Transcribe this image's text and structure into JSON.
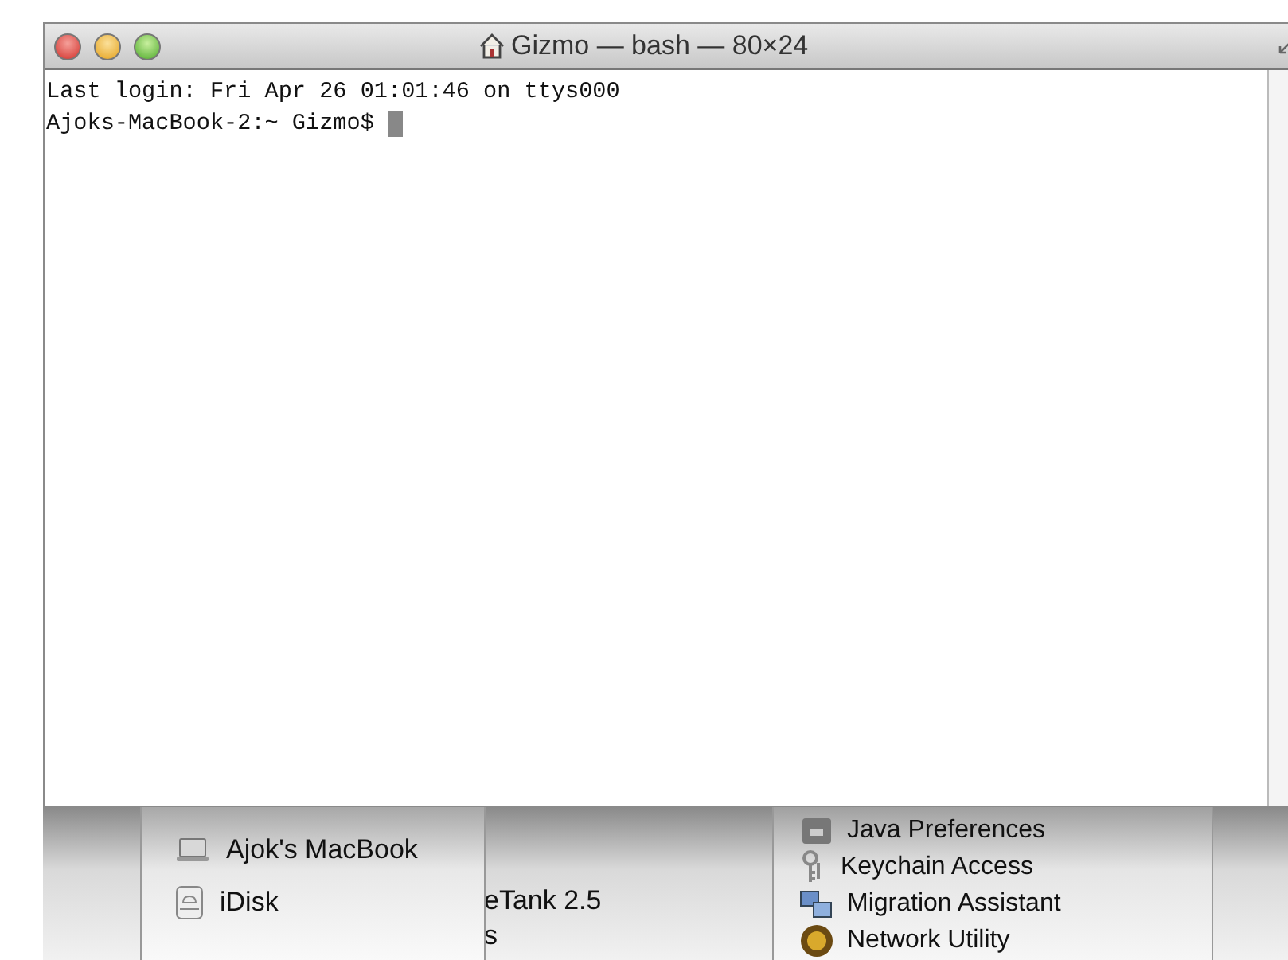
{
  "window": {
    "title": "Gizmo — bash — 80×24"
  },
  "terminal": {
    "lines": [
      "Last login: Fri Apr 26 01:01:46 on ttys000",
      "Ajoks-MacBook-2:~ Gizmo$"
    ],
    "cursor": true
  },
  "background_window": {
    "sidebar": {
      "items": [
        {
          "label": "Ajok's MacBook",
          "kind": "computer"
        },
        {
          "label": "iDisk",
          "kind": "disk"
        }
      ]
    },
    "column_2": {
      "items": [
        "eTank 2.5",
        "s"
      ]
    },
    "column_3": {
      "items": [
        {
          "label": "Java Preferences",
          "kind": "java"
        },
        {
          "label": "Keychain Access",
          "kind": "keychain"
        },
        {
          "label": "Migration Assistant",
          "kind": "migration"
        },
        {
          "label": "Network Utility",
          "kind": "network"
        }
      ]
    }
  }
}
